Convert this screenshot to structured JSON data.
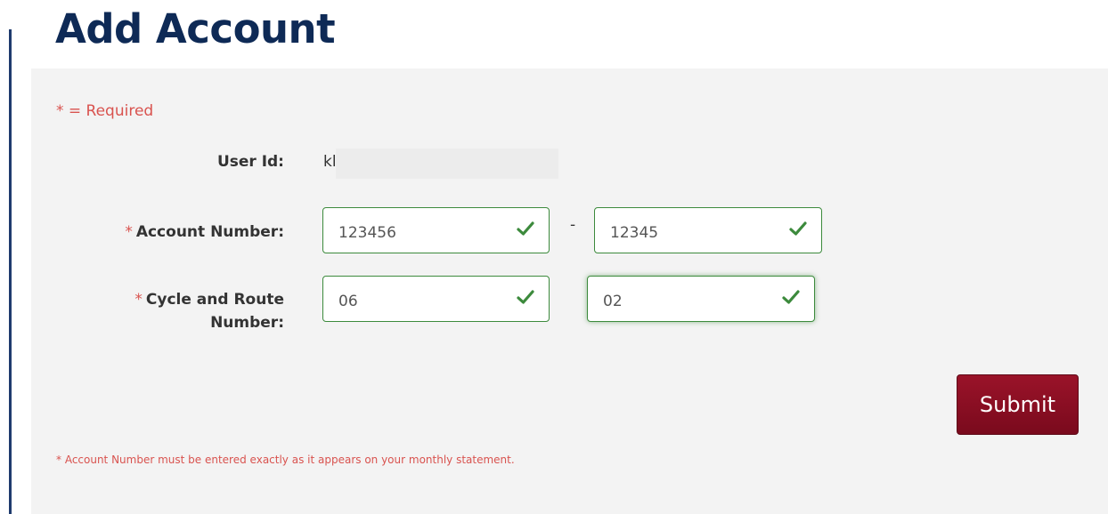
{
  "page": {
    "title": "Add Account"
  },
  "form": {
    "required_note": "* = Required",
    "user_id": {
      "label": "User Id:",
      "value": "kl"
    },
    "account_number": {
      "required_marker": "*",
      "label": "Account Number:",
      "part1": {
        "value": "123456",
        "placeholder": ""
      },
      "separator": "-",
      "part2": {
        "value": "12345",
        "placeholder": ""
      }
    },
    "cycle_route": {
      "required_marker": "*",
      "label_line1": "Cycle and Route",
      "label_line2": "Number:",
      "cycle": {
        "value": "06",
        "placeholder": ""
      },
      "route": {
        "value": "02",
        "placeholder": ""
      }
    },
    "submit_label": "Submit",
    "footnote": "* Account Number must be entered exactly as it appears on your monthly statement."
  },
  "icons": {
    "valid": "check-icon"
  },
  "colors": {
    "title": "#0e2a56",
    "required": "#d9534f",
    "valid": "#3c8a3c",
    "submit_bg": "#8b0c22",
    "panel_bg": "#f3f3f3"
  }
}
